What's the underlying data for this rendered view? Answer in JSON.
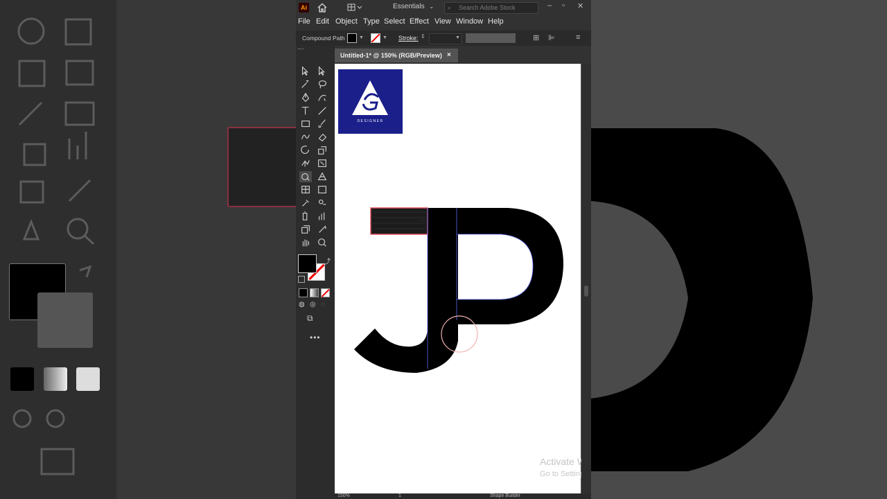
{
  "app": {
    "logo_text": "Ai",
    "workspace": "Essentials",
    "search_placeholder": "Search Adobe Stock"
  },
  "menu": [
    "File",
    "Edit",
    "Object",
    "Type",
    "Select",
    "Effect",
    "View",
    "Window",
    "Help"
  ],
  "control_bar": {
    "selection_type": "Compound Path",
    "stroke_label": "Stroke:"
  },
  "document": {
    "tab_title": "Untitled-1* @ 150% (RGB/Preview)",
    "close_label": "×"
  },
  "artboard": {
    "logo_caption": "DESIGNER",
    "logo_letter": "G"
  },
  "status": {
    "zoom": "150%",
    "artboard_number": "1",
    "current_tool": "Shape Builder"
  },
  "watermark": {
    "line1": "Activate W",
    "line2": "Go to Settings"
  },
  "colors": {
    "ui_dark": "#323232",
    "canvas_bg": "#535353",
    "artboard": "#ffffff",
    "fill": "#000000",
    "stroke_none": "#e00000",
    "selection": "#4a6cf7",
    "logo_bg": "#1a1f8a"
  },
  "tools": [
    "selection-tool-icon",
    "direct-selection-tool-icon",
    "magic-wand-tool-icon",
    "lasso-tool-icon",
    "pen-tool-icon",
    "curvature-tool-icon",
    "type-tool-icon",
    "line-segment-tool-icon",
    "rectangle-tool-icon",
    "paintbrush-tool-icon",
    "shaper-tool-icon",
    "eraser-tool-icon",
    "rotate-tool-icon",
    "scale-tool-icon",
    "puppet-warp-tool-icon",
    "free-transform-tool-icon",
    "shape-builder-tool-icon",
    "perspective-grid-tool-icon",
    "mesh-tool-icon",
    "gradient-tool-icon",
    "eyedropper-tool-icon",
    "blend-tool-icon",
    "symbol-sprayer-tool-icon",
    "column-graph-tool-icon",
    "artboard-tool-icon",
    "slice-tool-icon",
    "hand-tool-icon",
    "zoom-tool-icon"
  ]
}
